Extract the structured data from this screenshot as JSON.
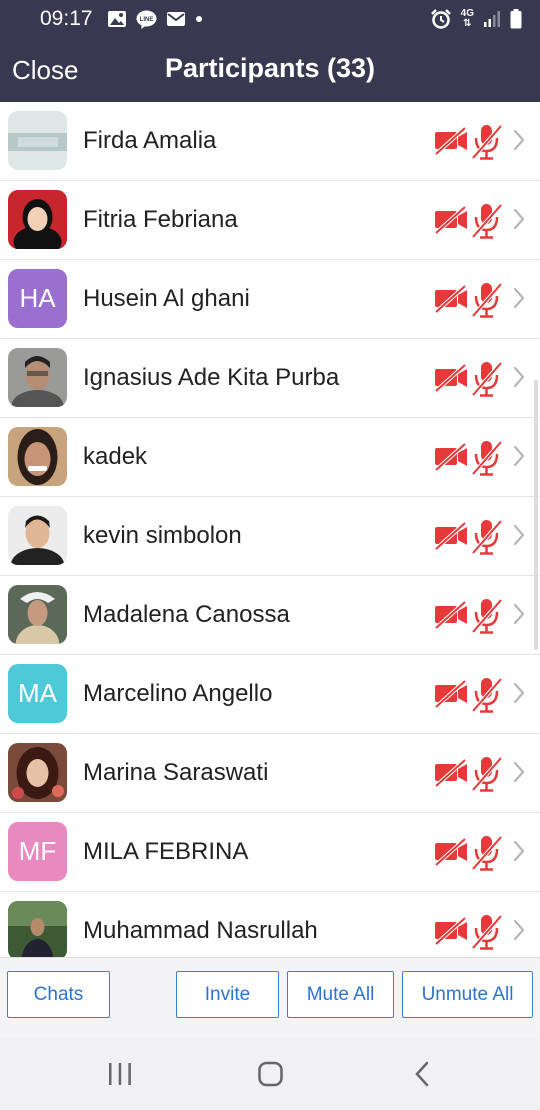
{
  "status_bar": {
    "time": "09:17",
    "network": "4G",
    "icons": [
      "gallery-icon",
      "line-app-icon",
      "mail-icon",
      "dot-icon",
      "alarm-icon",
      "signal-icon",
      "battery-icon"
    ]
  },
  "header": {
    "close_label": "Close",
    "title": "Participants (33)"
  },
  "participants": [
    {
      "name": "Firda Amalia",
      "avatar": "photo",
      "camera": "off",
      "mic": "muted"
    },
    {
      "name": "Fitria Febriana",
      "avatar": "photo",
      "camera": "off",
      "mic": "muted"
    },
    {
      "name": "Husein Al ghani",
      "avatar": "initials",
      "initials": "HA",
      "avatar_color": "#9a6fd0",
      "camera": "off",
      "mic": "muted"
    },
    {
      "name": "Ignasius Ade Kita Purba",
      "avatar": "photo",
      "camera": "off",
      "mic": "muted"
    },
    {
      "name": "kadek",
      "avatar": "photo",
      "camera": "off",
      "mic": "muted"
    },
    {
      "name": "kevin simbolon",
      "avatar": "photo",
      "camera": "off",
      "mic": "muted"
    },
    {
      "name": "Madalena Canossa",
      "avatar": "photo",
      "camera": "off",
      "mic": "muted"
    },
    {
      "name": "Marcelino Angello",
      "avatar": "initials",
      "initials": "MA",
      "avatar_color": "#4ec9d8",
      "camera": "off",
      "mic": "muted"
    },
    {
      "name": "Marina Saraswati",
      "avatar": "photo",
      "camera": "off",
      "mic": "muted"
    },
    {
      "name": "MILA FEBRINA",
      "avatar": "initials",
      "initials": "MF",
      "avatar_color": "#e88ac0",
      "camera": "off",
      "mic": "muted"
    },
    {
      "name": "Muhammad Nasrullah",
      "avatar": "photo",
      "camera": "off",
      "mic": "muted"
    }
  ],
  "toolbar": {
    "chats_label": "Chats",
    "invite_label": "Invite",
    "mute_all_label": "Mute All",
    "unmute_all_label": "Unmute All"
  },
  "colors": {
    "header_bg": "#383850",
    "muted_red": "#e63a3a",
    "button_blue": "#2d74cf"
  }
}
